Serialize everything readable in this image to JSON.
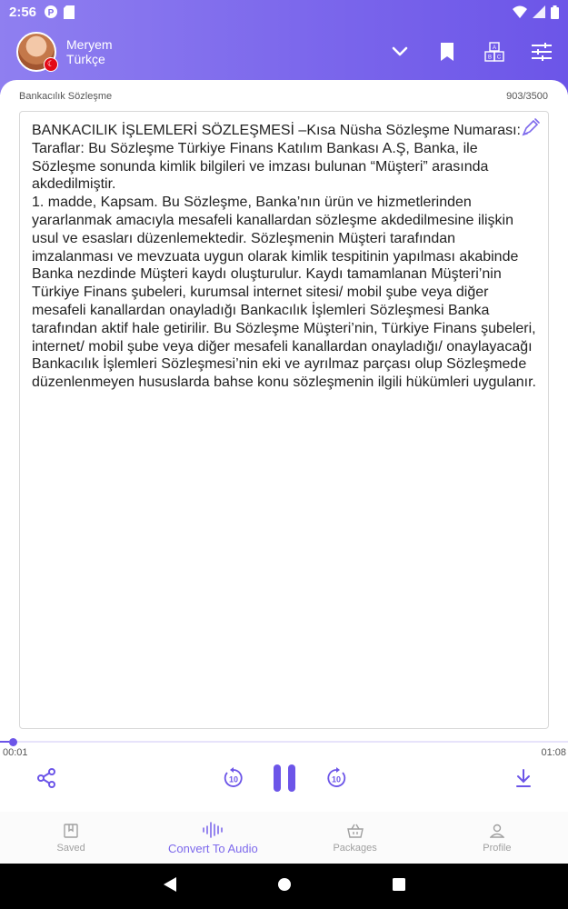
{
  "status_bar": {
    "time": "2:56"
  },
  "header": {
    "user_name": "Meryem",
    "language": "Türkçe"
  },
  "document": {
    "title": "Bankacılık Sözleşme",
    "char_count": "903/3500",
    "text": "BANKACILIK İŞLEMLERİ SÖZLEŞMESİ –Kısa Nüsha Sözleşme Numarası:\nTaraflar: Bu Sözleşme Türkiye Finans Katılım Bankası A.Ş, Banka, ile Sözleşme sonunda kimlik bilgileri ve imzası bulunan “Müşteri” arasında akdedilmiştir.\n1. madde, Kapsam. Bu Sözleşme, Banka’nın ürün ve hizmetlerinden yararlanmak amacıyla mesafeli kanallardan sözleşme akdedilmesine ilişkin usul ve esasları düzenlemektedir. Sözleşmenin Müşteri tarafından imzalanması ve mevzuata uygun olarak kimlik tespitinin yapılması akabinde Banka nezdinde Müşteri kaydı oluşturulur. Kaydı tamamlanan Müşteri’nin Türkiye Finans şubeleri, kurumsal internet sitesi/ mobil şube veya diğer mesafeli kanallardan onayladığı Bankacılık İşlemleri Sözleşmesi Banka tarafından aktif hale getirilir. Bu Sözleşme Müşteri’nin, Türkiye Finans şubeleri, internet/ mobil şube veya diğer mesafeli kanallardan onayladığı/ onaylayacağı Bankacılık İşlemleri Sözleşmesi’nin eki ve ayrılmaz parçası olup Sözleşmede düzenlenmeyen hususlarda bahse konu sözleşmenin ilgili hükümleri uygulanır."
  },
  "player": {
    "current_time": "00:01",
    "total_time": "01:08",
    "progress": 0.016,
    "skip_back_label": "10",
    "skip_forward_label": "10"
  },
  "nav": {
    "items": [
      {
        "label": "Saved",
        "icon": "bookmark-box-icon"
      },
      {
        "label": "Convert To Audio",
        "icon": "waveform-icon"
      },
      {
        "label": "Packages",
        "icon": "basket-icon"
      },
      {
        "label": "Profile",
        "icon": "person-icon"
      }
    ]
  },
  "colors": {
    "accent": "#6c55e8",
    "header_gradient_start": "#8f7ff0",
    "header_gradient_end": "#6c55e8",
    "nav_inactive": "#a0a0a0"
  }
}
